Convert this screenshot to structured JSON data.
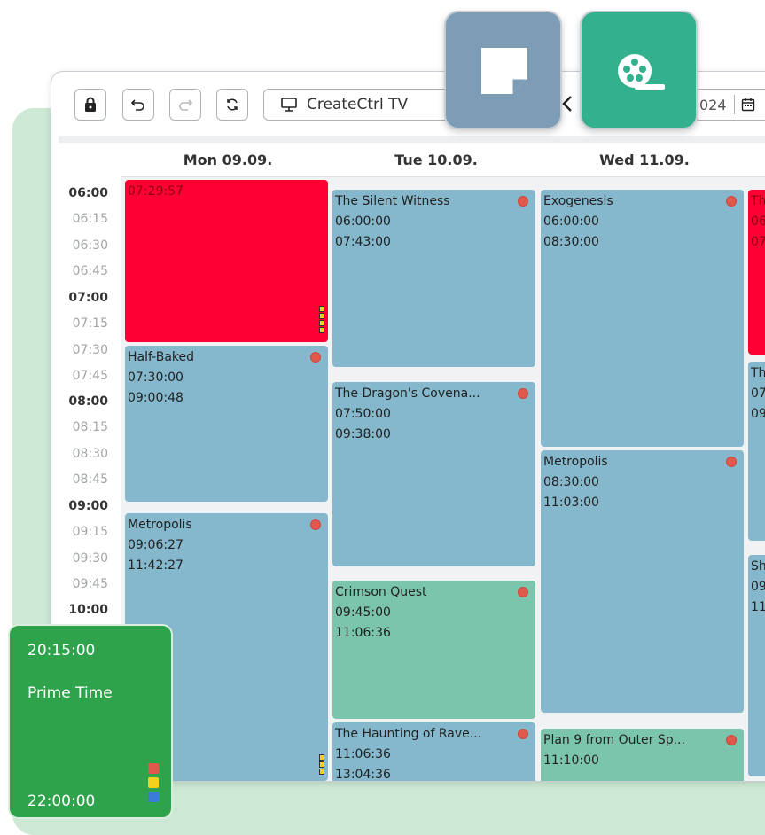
{
  "toolbar": {
    "channel": "CreateCtrl TV",
    "date_fragment": "024"
  },
  "days": [
    {
      "label": "Mon 09.09."
    },
    {
      "label": "Tue 10.09."
    },
    {
      "label": "Wed 11.09."
    }
  ],
  "times": [
    "06:00",
    "06:15",
    "06:30",
    "06:45",
    "07:00",
    "07:15",
    "07:30",
    "07:45",
    "08:00",
    "08:15",
    "08:30",
    "08:45",
    "09:00",
    "09:15",
    "09:30",
    "09:45",
    "10:00"
  ],
  "events": {
    "mon": [
      {
        "title": "07:29:57"
      },
      {
        "title": "Half-Baked",
        "start": "07:30:00",
        "end": "09:00:48"
      },
      {
        "title": "Metropolis",
        "start": "09:06:27",
        "end": "11:42:27"
      }
    ],
    "tue": [
      {
        "title": "The Silent Witness",
        "start": "06:00:00",
        "end": "07:43:00"
      },
      {
        "title": "The Dragon's Covena...",
        "start": "07:50:00",
        "end": "09:38:00"
      },
      {
        "title": "Crimson Quest",
        "start": "09:45:00",
        "end": "11:06:36"
      },
      {
        "title": "The Haunting of Rave...",
        "start": "11:06:36",
        "end": "13:04:36"
      }
    ],
    "wed": [
      {
        "title": "Exogenesis",
        "start": "06:00:00",
        "end": "08:30:00"
      },
      {
        "title": "Metropolis",
        "start": "08:30:00",
        "end": "11:03:00"
      },
      {
        "title": "Plan 9 from Outer Sp...",
        "start": "11:10:00"
      }
    ],
    "thu": [
      {
        "title": "Th",
        "start": "06",
        "end": "07"
      },
      {
        "title": "Th",
        "start": "07",
        "end": "09"
      },
      {
        "title": "Sh",
        "start": "09",
        "end": "11"
      }
    ]
  },
  "prime_time": {
    "start": "20:15:00",
    "label": "Prime Time",
    "end": "22:00:00",
    "marker_colors": [
      "#e0594c",
      "#f2d21e",
      "#3a7bd5"
    ]
  },
  "colors": {
    "event_blue": "#85b8cc",
    "event_green": "#7bc5ad",
    "event_red": "#ff0033",
    "prime_green": "#2ea34b",
    "note_card": "#7d9cb5",
    "film_card": "#33b08e"
  }
}
